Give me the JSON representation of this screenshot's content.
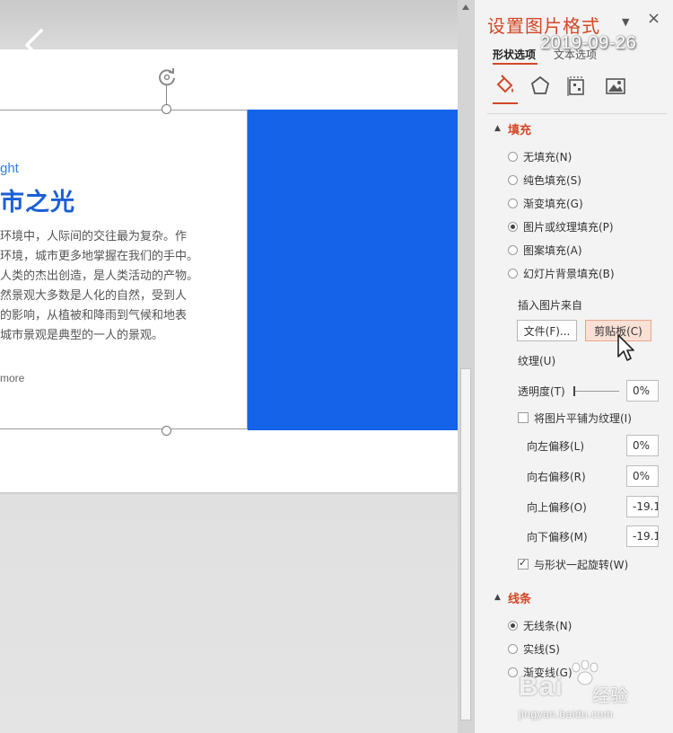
{
  "slide": {
    "kicker": "ght",
    "title": "市之光",
    "body_lines": [
      "环境中，人际间的交往最为复杂。作",
      "环境，城市更多地掌握在我们的手中。",
      "人类的杰出创造，是人类活动的产物。",
      "然景观大多数是人化的自然，受到人",
      "的影响，从植被和降雨到气候和地表",
      "城市景观是典型的一人的景观。"
    ],
    "more": "more",
    "accent_color": "#1463e8"
  },
  "pane": {
    "title": "设置图片格式",
    "dropdown_icon": "▼",
    "close_icon": "×",
    "date": "2019-09-26",
    "tabs": [
      "形状选项",
      "文本选项"
    ],
    "icons": [
      "fill-line-icon",
      "effects-pentagon-icon",
      "size-properties-icon",
      "picture-icon"
    ],
    "fill_section": {
      "title": "填充",
      "options": [
        {
          "label": "无填充(N)",
          "checked": false
        },
        {
          "label": "纯色填充(S)",
          "checked": false
        },
        {
          "label": "渐变填充(G)",
          "checked": false
        },
        {
          "label": "图片或纹理填充(P)",
          "checked": true
        },
        {
          "label": "图案填充(A)",
          "checked": false
        },
        {
          "label": "幻灯片背景填充(B)",
          "checked": false
        }
      ],
      "insert_from": "插入图片来自",
      "file_button": "文件(F)...",
      "clipboard_button": "剪贴板(C)",
      "texture": "纹理(U)",
      "transparency_label": "透明度(T)",
      "transparency_value": "0%",
      "tile_label": "将图片平铺为纹理(I)",
      "offsets": [
        {
          "label": "向左偏移(L)",
          "value": "0%"
        },
        {
          "label": "向右偏移(R)",
          "value": "0%"
        },
        {
          "label": "向上偏移(O)",
          "value": "-19.1"
        },
        {
          "label": "向下偏移(M)",
          "value": "-19.1"
        }
      ],
      "rotate_label": "与形状一起旋转(W)"
    },
    "line_section": {
      "title": "线条",
      "options": [
        {
          "label": "无线条(N)",
          "checked": true
        },
        {
          "label": "实线(S)",
          "checked": false
        },
        {
          "label": "渐变线(G)",
          "checked": false
        }
      ]
    }
  },
  "watermark": {
    "brand": "Bai",
    "brand_cn": "经验",
    "url": "jingyan.baidu.com"
  }
}
